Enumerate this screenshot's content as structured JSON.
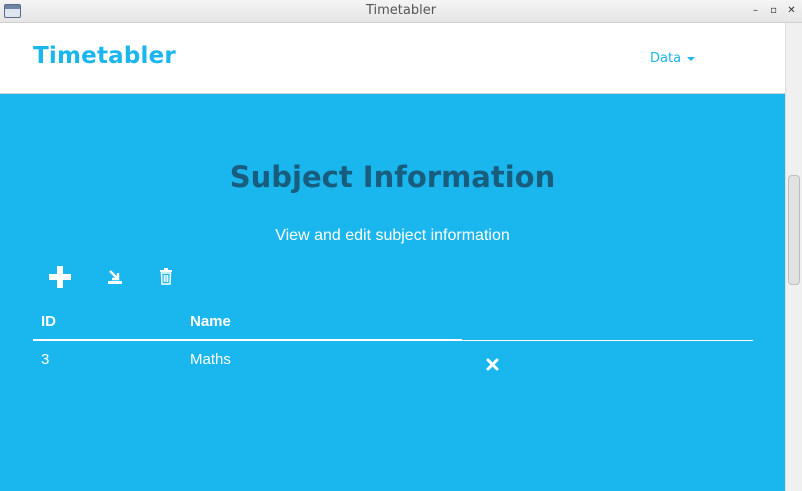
{
  "window": {
    "title": "Timetabler",
    "controls": {
      "minimize": "–",
      "maximize": "▫",
      "close": "✕"
    }
  },
  "navbar": {
    "brand": "Timetabler",
    "menu_label": "Data"
  },
  "page": {
    "title": "Subject Information",
    "subtitle": "View and edit subject information"
  },
  "toolbar": {
    "icons": [
      "add-icon",
      "export-icon",
      "trash-icon"
    ]
  },
  "table": {
    "columns": [
      "ID",
      "Name"
    ],
    "rows": [
      {
        "id": "3",
        "name": "Maths"
      }
    ]
  },
  "colors": {
    "accent": "#1ab6ee",
    "title": "#185d7e",
    "white": "#ffffff"
  }
}
